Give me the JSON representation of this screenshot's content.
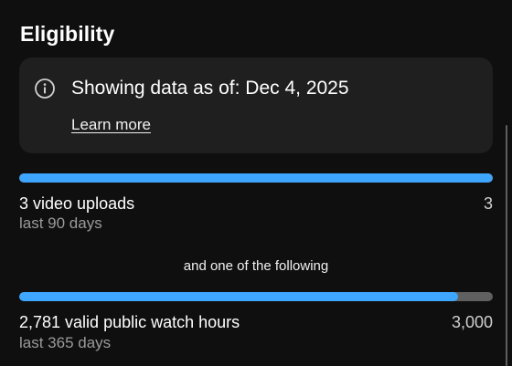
{
  "section": {
    "title": "Eligibility"
  },
  "notice": {
    "icon": "info-icon",
    "text": "Showing data as of: Dec 4, 2025",
    "learn_more_label": "Learn more"
  },
  "requirements": [
    {
      "label": "3 video uploads",
      "sublabel": "last 90 days",
      "target": "3",
      "progress_fraction": 1.0
    },
    {
      "label": "2,781 valid public watch hours",
      "sublabel": "last 365 days",
      "target": "3,000",
      "progress_fraction": 0.927
    }
  ],
  "separator_text": "and one of the following",
  "colors": {
    "background": "#0f0f0f",
    "card": "#1f1f1f",
    "progress_fill": "#3ea6ff",
    "progress_track": "#606060",
    "secondary_text": "#9a9a9a"
  }
}
